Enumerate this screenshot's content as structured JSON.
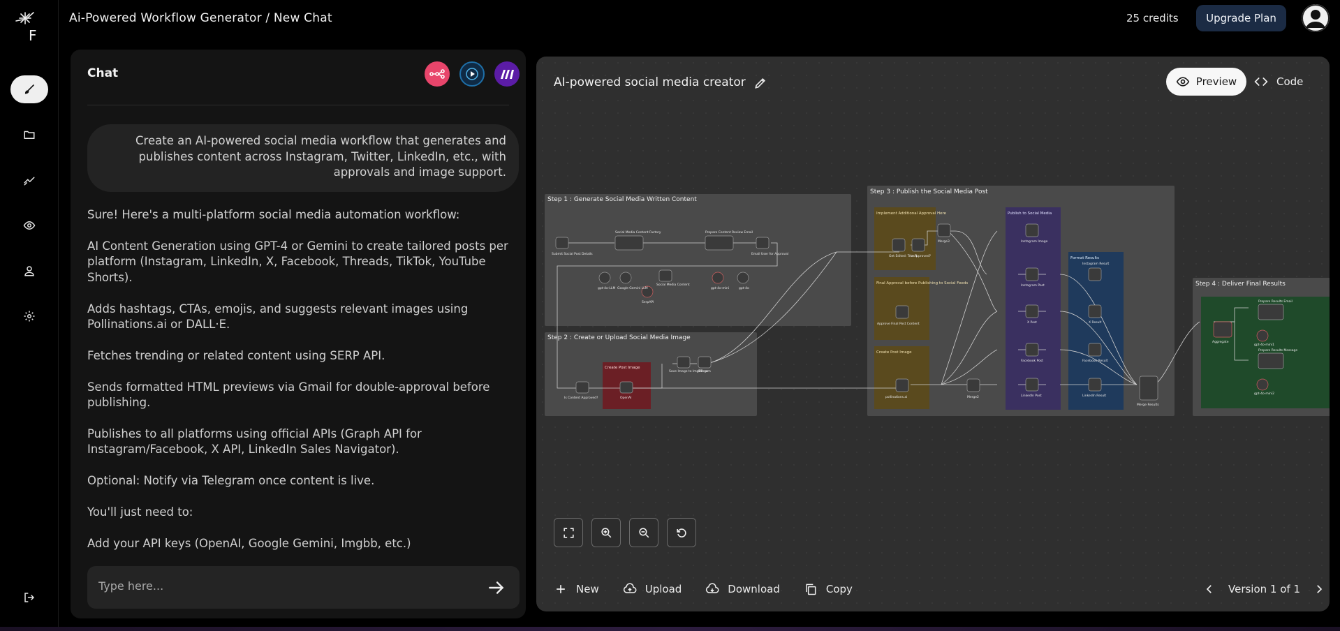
{
  "header": {
    "title": "Ai-Powered Workflow Generator / New Chat",
    "credits": "25 credits",
    "upgrade_label": "Upgrade Plan",
    "logo_letter": "F"
  },
  "sidebar": {
    "items": [
      {
        "icon": "brush-icon",
        "active": true
      },
      {
        "icon": "folder-icon",
        "active": false
      },
      {
        "icon": "chart-icon",
        "active": false
      },
      {
        "icon": "eye-icon",
        "active": false
      },
      {
        "icon": "user-icon",
        "active": false
      },
      {
        "icon": "gear-icon",
        "active": false
      },
      {
        "icon": "logout-icon",
        "active": false
      }
    ]
  },
  "chat": {
    "title": "Chat",
    "integrations": [
      {
        "name": "n8n",
        "color": "#e8456b"
      },
      {
        "name": "pipedream",
        "color": "#0f2a44"
      },
      {
        "name": "make",
        "color": "#5b1ca6"
      }
    ],
    "user_message": "Create an AI-powered social media workflow that generates and publishes content across Instagram, Twitter, LinkedIn, etc., with approvals and image support.",
    "assistant_paragraphs": [
      "Sure! Here's a multi-platform social media automation workflow:",
      "AI Content Generation using GPT-4 or Gemini to create tailored posts per platform (Instagram, LinkedIn, X, Facebook, Threads, TikTok, YouTube Shorts).",
      "Adds hashtags, CTAs, emojis, and suggests relevant images using Pollinations.ai or DALL·E.",
      "Fetches trending or related content using SERP API.",
      "Sends formatted HTML previews via Gmail for double-approval before publishing.",
      "Publishes to all platforms using official APIs (Graph API for Instagram/Facebook, X API, LinkedIn Sales Navigator).",
      "Optional: Notify via Telegram once content is live.",
      "You'll just need to:",
      "Add your API keys (OpenAI, Google Gemini, Imgbb, etc.)"
    ],
    "input_placeholder": "Type here..."
  },
  "workflow": {
    "title": "AI-powered social media creator",
    "preview_label": "Preview",
    "code_label": "Code",
    "groups": [
      {
        "label": "Step 1 : Generate Social Media Written Content",
        "color": "#4a4a4a"
      },
      {
        "label": "Step 2 : Create or Upload Social Media Image",
        "color": "#4a4a4a"
      },
      {
        "label": "Step 3 : Publish the Social Media Post",
        "color": "#4a4a4a"
      },
      {
        "label": "Step 4 : Deliver Final Results",
        "color": "#4a4a4a"
      },
      {
        "label": "Implement Additional Approval Here",
        "color": "#5a4a1e"
      },
      {
        "label": "Final Approval before Publishing to Social Feeds",
        "color": "#5a4a1e"
      },
      {
        "label": "Create Post Image",
        "color": "#5a4a1e"
      },
      {
        "label": "Publish to Social Media",
        "color": "#3a3060"
      },
      {
        "label": "Format Results",
        "color": "#1f3a5c"
      },
      {
        "label": "Create Post Image",
        "color": "#6b1f25"
      }
    ],
    "nodes": [
      {
        "label": "Submit Social Post Details"
      },
      {
        "label": "Social Media Content Factory"
      },
      {
        "label": "Prepare Content Review Email"
      },
      {
        "label": "Email User for Approval"
      },
      {
        "label": "gpt-4o-LLM"
      },
      {
        "label": "Google Gemini LLM"
      },
      {
        "label": "Social Media Content"
      },
      {
        "label": "gpt-4o-mini"
      },
      {
        "label": "gpt-4o"
      },
      {
        "label": "SerpAPI"
      },
      {
        "label": "Is Content Approved?"
      },
      {
        "label": "OpenAI"
      },
      {
        "label": "Save Image to ImgBB.com"
      },
      {
        "label": "Merge"
      },
      {
        "label": "Get Edited: True 1"
      },
      {
        "label": "Is Approved?"
      },
      {
        "label": "Merge3"
      },
      {
        "label": "Approve Final Post Content"
      },
      {
        "label": "pollinations.ai"
      },
      {
        "label": "Merge2"
      },
      {
        "label": "Instagram Image"
      },
      {
        "label": "Instagram Post"
      },
      {
        "label": "X Post"
      },
      {
        "label": "Facebook Post"
      },
      {
        "label": "LinkedIn Post"
      },
      {
        "label": "Instagram Result"
      },
      {
        "label": "X Result"
      },
      {
        "label": "Facebook Result"
      },
      {
        "label": "LinkedIn Result"
      },
      {
        "label": "Merge Results"
      },
      {
        "label": "Aggregate"
      },
      {
        "label": "Prepare Results Email"
      },
      {
        "label": "Prepare Results Message"
      },
      {
        "label": "gpt-4o-mini1"
      },
      {
        "label": "gpt-4o-mini2"
      }
    ],
    "toolbar": {
      "new_label": "New",
      "upload_label": "Upload",
      "download_label": "Download",
      "copy_label": "Copy",
      "version_label": "Version 1 of 1"
    }
  }
}
